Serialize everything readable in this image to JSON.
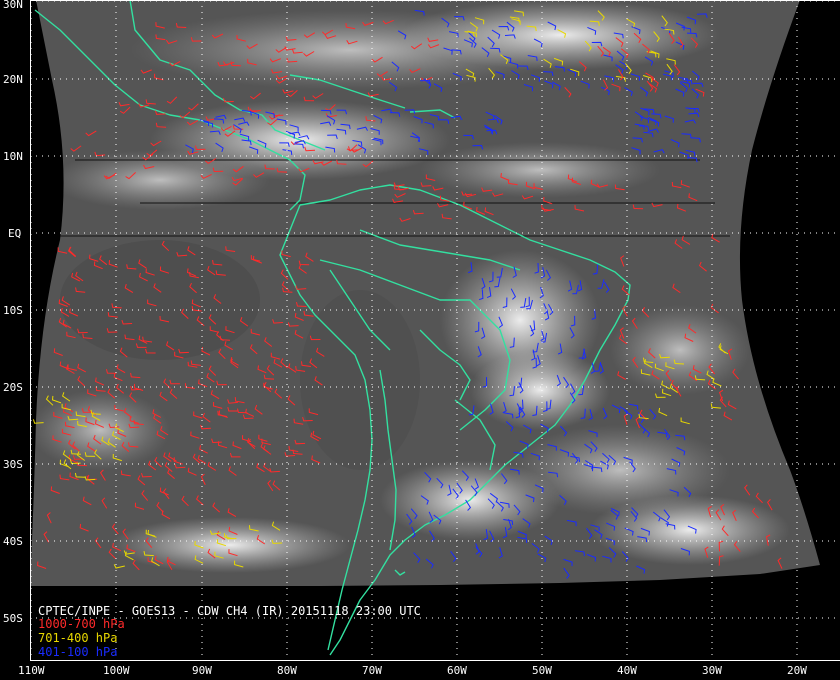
{
  "title": "CPTEC/INPE - GOES13 - CDW CH4 (IR) 20151118 23:00 UTC",
  "legend": [
    {
      "label": "1000-700 hPa",
      "color": "#ff2a2a"
    },
    {
      "label": "701-400 hPa",
      "color": "#e8d800"
    },
    {
      "label": "401-100 hPa",
      "color": "#1a2cff"
    }
  ],
  "lat_labels": [
    "30N",
    "20N",
    "10N",
    "EQ",
    "10S",
    "20S",
    "30S",
    "40S",
    "50S"
  ],
  "lon_labels": [
    "110W",
    "100W",
    "90W",
    "80W",
    "70W",
    "60W",
    "50W",
    "40W",
    "30W",
    "20W"
  ],
  "colors": {
    "coastline": "#33e0a0",
    "grid": "#ffffff",
    "background": "#000000"
  }
}
